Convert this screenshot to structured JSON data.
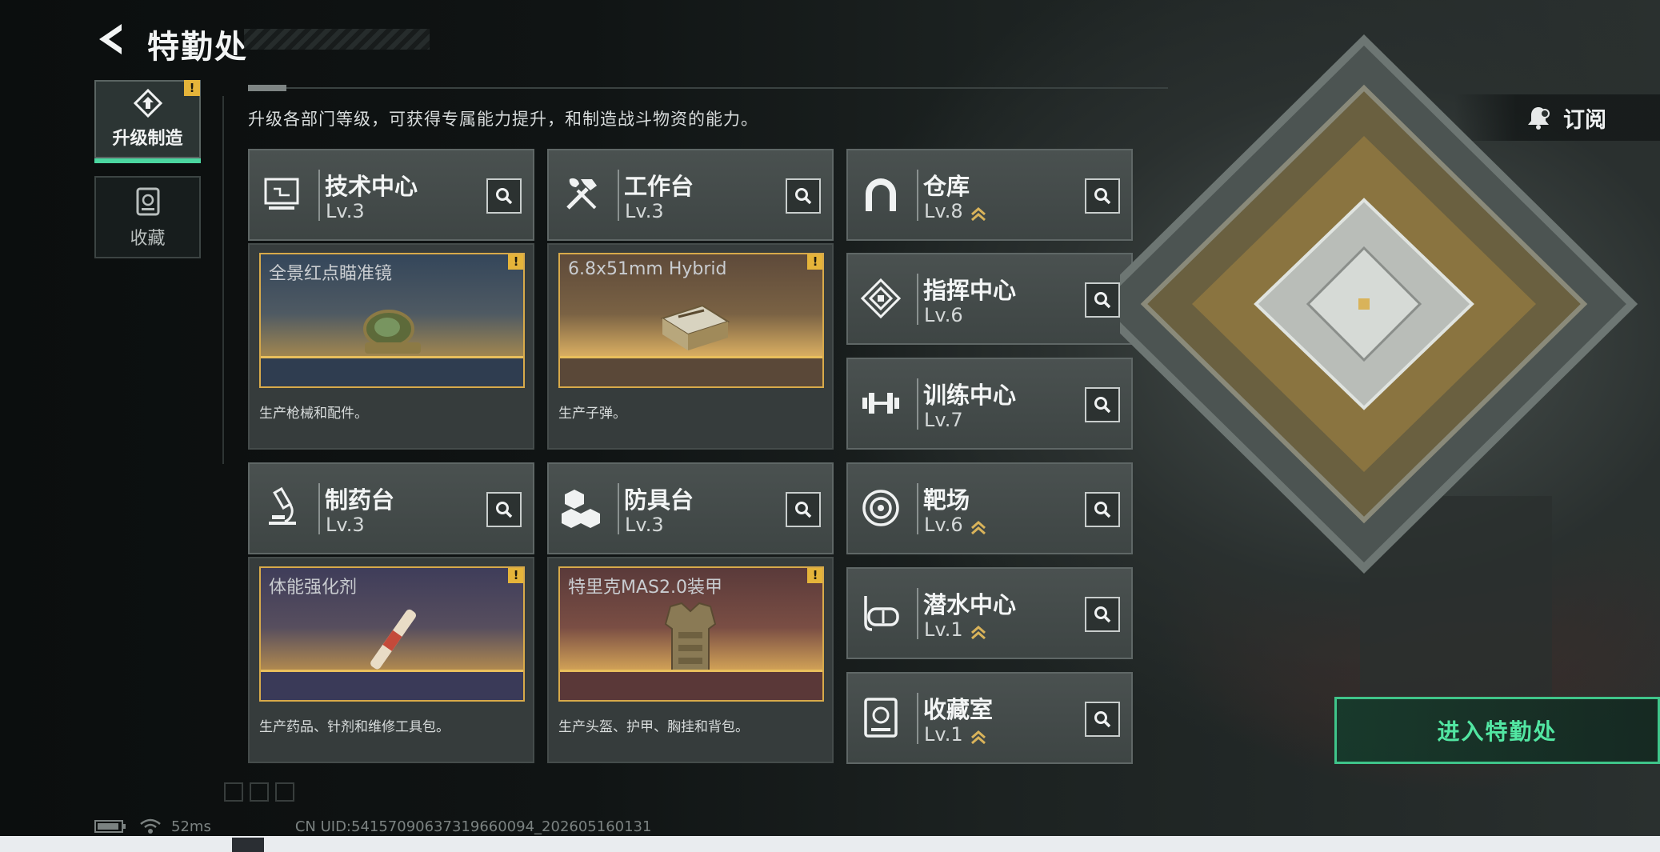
{
  "header": {
    "title": "特勤处"
  },
  "nav": [
    {
      "label": "升级制造",
      "active": true,
      "alert": "!"
    },
    {
      "label": "收藏",
      "active": false
    }
  ],
  "description": "升级各部门等级，可获得专属能力提升，和制造战斗物资的能力。",
  "subscribe": {
    "label": "订阅"
  },
  "production_departments": [
    {
      "name": "技术中心",
      "level": "Lv.3",
      "icon": "computer-icon",
      "product": "全景红点瞄准镜",
      "product_desc": "生产枪械和配件。",
      "alert": "!",
      "bg": "#3a4b5e"
    },
    {
      "name": "工作台",
      "level": "Lv.3",
      "icon": "tools-icon",
      "product": "6.8x51mm Hybrid",
      "product_desc": "生产子弹。",
      "alert": "!",
      "bg": "#6a5640"
    },
    {
      "name": "制药台",
      "level": "Lv.3",
      "icon": "microscope-icon",
      "product": "体能强化剂",
      "product_desc": "生产药品、针剂和维修工具包。",
      "alert": "!",
      "bg": "#4a4a66"
    },
    {
      "name": "防具台",
      "level": "Lv.3",
      "icon": "cubes-icon",
      "product": "特里克MAS2.0装甲",
      "product_desc": "生产头盔、护甲、胸挂和背包。",
      "alert": "!",
      "bg": "#6a4242"
    }
  ],
  "facilities": [
    {
      "name": "仓库",
      "level": "Lv.8",
      "icon": "arch-icon",
      "upgradable": true
    },
    {
      "name": "指挥中心",
      "level": "Lv.6",
      "icon": "chip-icon",
      "upgradable": false
    },
    {
      "name": "训练中心",
      "level": "Lv.7",
      "icon": "dumbbell-icon",
      "upgradable": false
    },
    {
      "name": "靶场",
      "level": "Lv.6",
      "icon": "target-icon",
      "upgradable": true
    },
    {
      "name": "潜水中心",
      "level": "Lv.1",
      "icon": "diving-mask-icon",
      "upgradable": true
    },
    {
      "name": "收藏室",
      "level": "Lv.1",
      "icon": "vault-icon",
      "upgradable": true
    }
  ],
  "enter_button": {
    "label": "进入特勤处"
  },
  "footer": {
    "ping": "52ms",
    "uid": "CN UID:541570906373196600​94_202605160131"
  },
  "colors": {
    "accent_green": "#4bd6a0",
    "alert_yellow": "#e5b43a",
    "product_border": "#d8aa4a"
  }
}
